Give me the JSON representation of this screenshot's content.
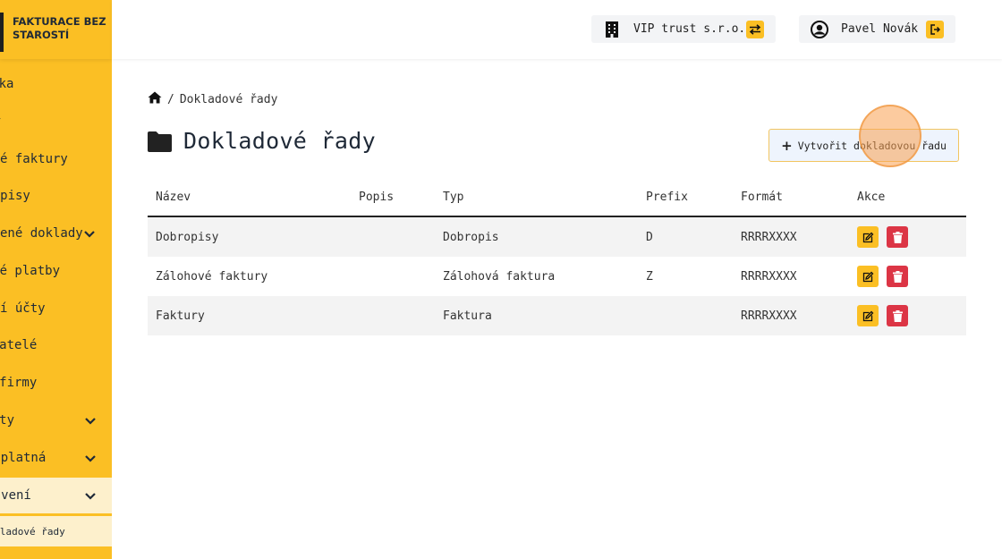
{
  "sidebar": {
    "logo_text": "FAKTURACE BEZ STAROSTÍ",
    "items": [
      {
        "label": "Nástěnka",
        "has_chevron": false
      },
      {
        "label": "Faktury",
        "has_chevron": false
      },
      {
        "label": "Zálohové faktury",
        "has_chevron": false
      },
      {
        "label": "Dobropisy",
        "has_chevron": false
      },
      {
        "label": "Neuhrazené doklady",
        "has_chevron": true
      },
      {
        "label": "Přijaté platby",
        "has_chevron": false
      },
      {
        "label": "Bankovní účty",
        "has_chevron": false
      },
      {
        "label": "Odběratelé",
        "has_chevron": false
      },
      {
        "label": "Moje firmy",
        "has_chevron": false
      },
      {
        "label": "Exporty",
        "has_chevron": true
      },
      {
        "label": "Předplatná",
        "has_chevron": true
      },
      {
        "label": "Nastavení",
        "has_chevron": true
      }
    ],
    "sub_item": "Dokladové řady"
  },
  "header": {
    "company": "VIP trust s.r.o.",
    "user": "Pavel Novák"
  },
  "breadcrumb": {
    "current": "Dokladové řady"
  },
  "page": {
    "title": "Dokladové řady",
    "create_button": "Vytvořit dokladovou řadu"
  },
  "table": {
    "columns": [
      "Název",
      "Popis",
      "Typ",
      "Prefix",
      "Formát",
      "Akce"
    ],
    "rows": [
      {
        "name": "Dobropisy",
        "description": "",
        "type": "Dobropis",
        "prefix": "D",
        "format": "RRRRXXXX"
      },
      {
        "name": "Zálohové faktury",
        "description": "",
        "type": "Zálohová faktura",
        "prefix": "Z",
        "format": "RRRRXXXX"
      },
      {
        "name": "Faktury",
        "description": "",
        "type": "Faktura",
        "prefix": "",
        "format": "RRRRXXXX"
      }
    ]
  },
  "colors": {
    "accent": "#fbbf24",
    "accent_light": "#fdf0cc",
    "danger": "#dc3545",
    "text": "#1f2937"
  }
}
